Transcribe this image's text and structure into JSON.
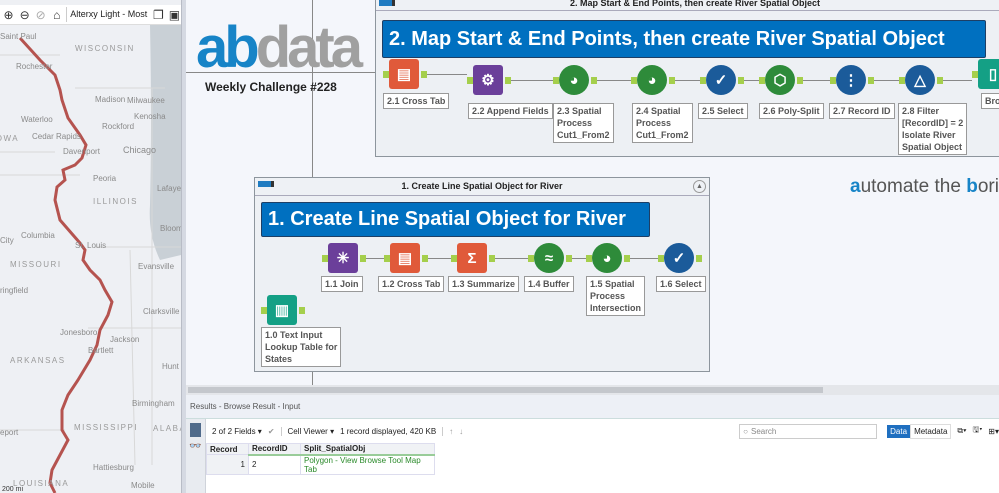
{
  "map": {
    "toolbar": {
      "basemap": "Alterxy Light - Most P",
      "icons": [
        "zoom-in-icon",
        "zoom-out-icon",
        "zoom-selection-icon",
        "home-icon",
        "copy-icon",
        "save-icon"
      ]
    },
    "labels": [
      "Saint Paul",
      "Rochester",
      "WISCONSIN",
      "Madison",
      "Milwaukee",
      "Kenosha",
      "Waterloo",
      "Rockford",
      "IOWA",
      "Cedar Rapids",
      "Davenport",
      "Chicago",
      "Peoria",
      "ILLINOIS",
      "Lafayette",
      "Columbia",
      "City",
      "Bloom",
      "St. Louis",
      "MISSOURI",
      "Evansville",
      "ringfield",
      "Clarksville",
      "Jonesboro",
      "Jackson",
      "Bartlett",
      "ARKANSAS",
      "Hunt",
      "Birmingham",
      "MISSISSIPPI",
      "ALABA",
      "eport",
      "Hattiesburg",
      "LOUISIANA",
      "Mobile"
    ],
    "scale": "200 mi",
    "river_color": "#b5534f"
  },
  "logo": {
    "ab": "ab",
    "data": "data",
    "subtitle": "Weekly Challenge #228",
    "tagline_a": "a",
    "tagline_1": "utomate the ",
    "tagline_b": "b",
    "tagline_2": "oring"
  },
  "container2": {
    "title": "2. Map Start & End Points, then create River Spatial Object",
    "banner": "2. Map Start & End Points, then create River Spatial Object",
    "tools": [
      {
        "label": "2.1 Cross Tab",
        "icon": "cross-tab-icon",
        "color": "#e05a3a"
      },
      {
        "label": "2.2 Append Fields",
        "icon": "append-fields-icon",
        "color": "#6b3f9a"
      },
      {
        "label": "2.3 Spatial\nProcess\nCut1_From2",
        "icon": "spatial-process-icon",
        "color": "#2e8b3a"
      },
      {
        "label": "2.4 Spatial\nProcess\nCut1_From2",
        "icon": "spatial-process-icon",
        "color": "#2e8b3a"
      },
      {
        "label": "2.5 Select",
        "icon": "select-icon",
        "color": "#1b5b9a"
      },
      {
        "label": "2.6 Poly-Split",
        "icon": "poly-split-icon",
        "color": "#2e8b3a"
      },
      {
        "label": "2.7 Record ID",
        "icon": "record-id-icon",
        "color": "#1b5b9a"
      },
      {
        "label": "2.8 Filter\n[RecordID] = 2\nIsolate River\nSpatial Object",
        "icon": "filter-icon",
        "color": "#1b5b9a"
      },
      {
        "label": "Bro",
        "icon": "browse-icon",
        "color": "#14a085"
      }
    ]
  },
  "container1": {
    "title": "1. Create Line Spatial Object for River",
    "banner": "1. Create Line Spatial Object for River",
    "tools": [
      {
        "label": "1.1 Join",
        "icon": "join-icon",
        "color": "#6b3f9a"
      },
      {
        "label": "1.2 Cross Tab",
        "icon": "cross-tab-icon",
        "color": "#e05a3a"
      },
      {
        "label": "1.3 Summarize",
        "icon": "summarize-icon",
        "color": "#e05a3a"
      },
      {
        "label": "1.4 Buffer",
        "icon": "buffer-icon",
        "color": "#2e8b3a"
      },
      {
        "label": "1.5 Spatial\nProcess\nIntersection",
        "icon": "spatial-process-icon",
        "color": "#2e8b3a"
      },
      {
        "label": "1.6 Select",
        "icon": "select-icon",
        "color": "#1b5b9a"
      },
      {
        "label": "1.0 Text Input\nLookup Table for\nStates",
        "icon": "text-input-icon",
        "color": "#14a085"
      }
    ]
  },
  "results": {
    "title": "Results - Browse Result - Input",
    "fields": "2 of 2 Fields",
    "viewer": "Cell Viewer",
    "summary": "1 record displayed, 420 KB",
    "search_placeholder": "Search",
    "data_tab": "Data",
    "metadata_tab": "Metadata",
    "columns": [
      "Record",
      "RecordID",
      "Split_SpatialObj"
    ],
    "rows": [
      [
        "1",
        "2",
        "Polygon - View Browse Tool Map Tab"
      ]
    ]
  }
}
